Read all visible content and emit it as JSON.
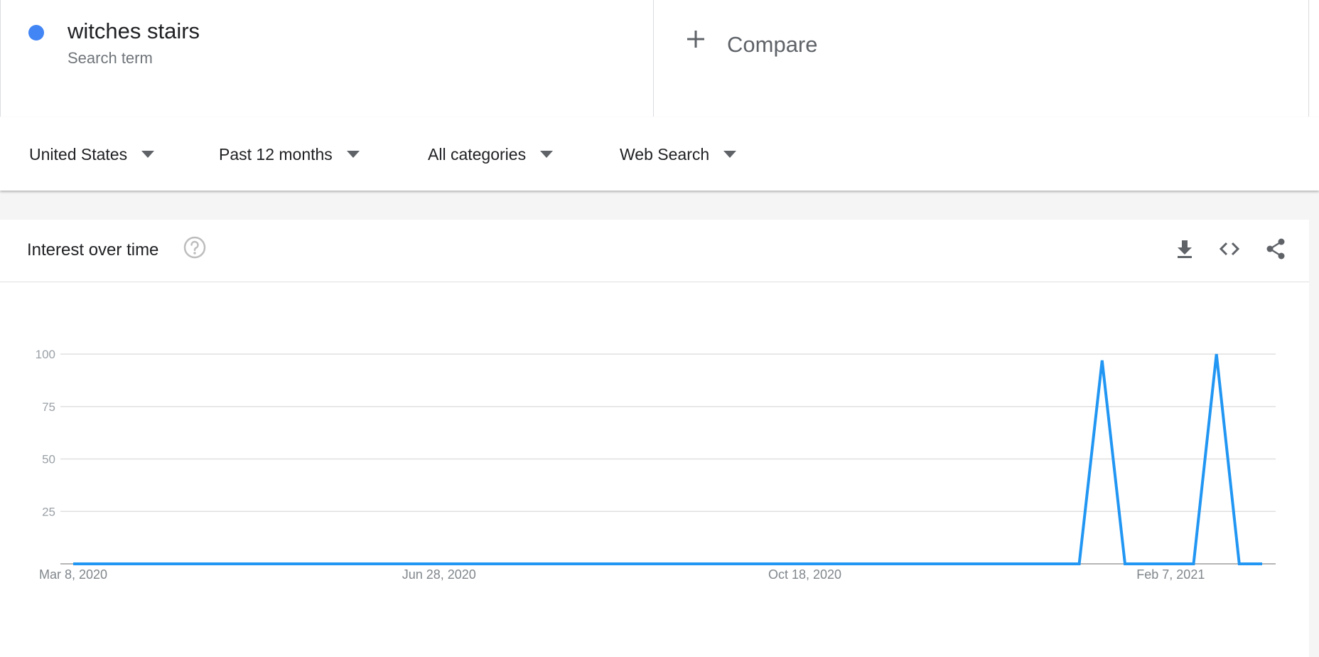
{
  "search_term": {
    "name": "witches stairs",
    "type": "Search term",
    "color": "#4285f4"
  },
  "compare": {
    "label": "Compare",
    "icon": "plus-icon"
  },
  "filters": [
    {
      "label": "United States"
    },
    {
      "label": "Past 12 months"
    },
    {
      "label": "All categories"
    },
    {
      "label": "Web Search"
    }
  ],
  "card": {
    "title": "Interest over time",
    "icons": [
      "help-icon",
      "download-icon",
      "embed-code-icon",
      "share-icon"
    ]
  },
  "chart_data": {
    "type": "line",
    "title": "",
    "xlabel": "",
    "ylabel": "",
    "ylim": [
      0,
      100
    ],
    "y_ticks": [
      25,
      50,
      75,
      100
    ],
    "x_tick_labels": [
      "Mar 8, 2020",
      "Jun 28, 2020",
      "Oct 18, 2020",
      "Feb 7, 2021"
    ],
    "grid": true,
    "series": [
      {
        "color": "#2196f3",
        "values": [
          0,
          0,
          0,
          0,
          0,
          0,
          0,
          0,
          0,
          0,
          0,
          0,
          0,
          0,
          0,
          0,
          0,
          0,
          0,
          0,
          0,
          0,
          0,
          0,
          0,
          0,
          0,
          0,
          0,
          0,
          0,
          0,
          0,
          0,
          0,
          0,
          0,
          0,
          0,
          0,
          0,
          0,
          0,
          0,
          0,
          97,
          0,
          0,
          0,
          0,
          100,
          0,
          0
        ]
      }
    ]
  }
}
